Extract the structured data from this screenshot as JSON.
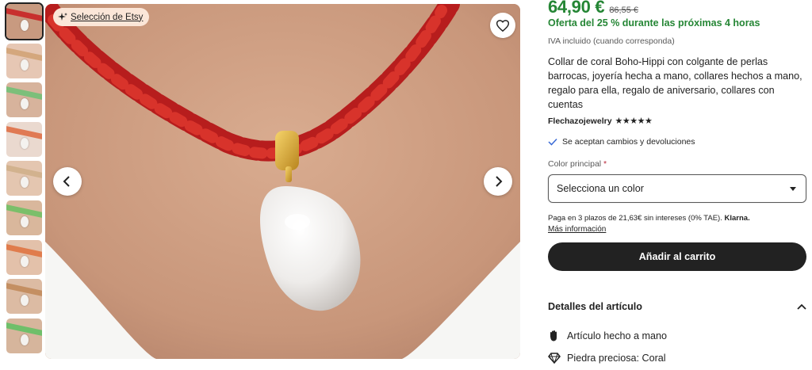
{
  "gallery": {
    "badge_label": "Selección de Etsy",
    "thumbnails": [
      {
        "skin": "#c89a80",
        "cord": "#c8302e"
      },
      {
        "skin": "#e6c7b4",
        "cord": "#d4a77d"
      },
      {
        "skin": "#d7b39c",
        "cord": "#7cbf7a"
      },
      {
        "skin": "#ead9cf",
        "cord": "#e07a54"
      },
      {
        "skin": "#e4c6b0",
        "cord": "#d2b28e"
      },
      {
        "skin": "#d9b79c",
        "cord": "#7bbf6a"
      },
      {
        "skin": "#e3c1aa",
        "cord": "#e07c4c"
      },
      {
        "skin": "#dcbba3",
        "cord": "#c48f62"
      },
      {
        "skin": "#d6b59c",
        "cord": "#6fbf6a"
      }
    ]
  },
  "product": {
    "price": "64,90 €",
    "old_price": "86,55 €",
    "offer": "Oferta del 25 % durante las próximas 4 horas",
    "vat_note": "IVA incluido (cuando corresponda)",
    "title": "Collar de coral Boho-Hippi con colgante de perlas barrocas, joyería hecha a mano, collares hechos a mano, regalo para ella, regalo de aniversario, collares con cuentas",
    "shop_name": "Flechazojewelry",
    "stars": "★★★★★",
    "returns": "Se aceptan cambios y devoluciones",
    "color_label": "Color principal",
    "color_required_mark": "*",
    "color_select_value": "Selecciona un color",
    "klarna_text": "Paga en 3 plazos de 21,63€ sin intereses (0% TAE).",
    "klarna_brand": "Klarna.",
    "more_info": "Más información",
    "add_to_cart": "Añadir al carrito"
  },
  "details": {
    "heading": "Detalles del artículo",
    "items": [
      {
        "icon": "hand-icon",
        "label": "Artículo hecho a mano"
      },
      {
        "icon": "gem-icon",
        "label": "Piedra preciosa: Coral"
      }
    ]
  },
  "colors": {
    "price_green": "#258635",
    "button_dark": "#222222",
    "badge_bg": "#fbe6d8",
    "required_red": "#b8283b"
  }
}
